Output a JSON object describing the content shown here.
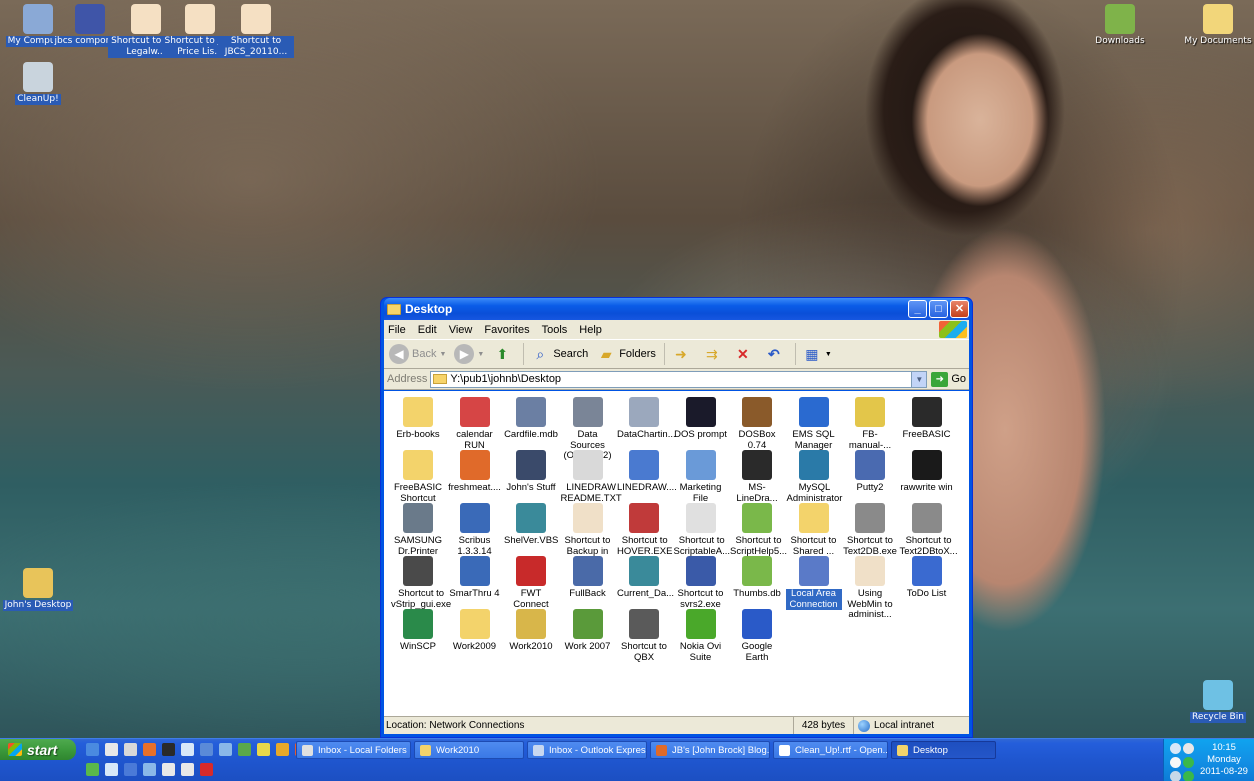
{
  "desktop": {
    "icons": [
      {
        "label": "My Computer",
        "icon": "computer-icon",
        "color": "#8aa9d6"
      },
      {
        "label": "jbcs compone...",
        "icon": "component-icon",
        "color": "#3f55a8"
      },
      {
        "label": "Shortcut to The Legalw...",
        "icon": "pdf-icon",
        "color": "#f5e0c3"
      },
      {
        "label": "Shortcut to jbcs Price Lis...",
        "icon": "pdf-icon",
        "color": "#f5e0c3"
      },
      {
        "label": "Shortcut to JBCS_20110...",
        "icon": "pdf-icon",
        "color": "#f5e0c3"
      },
      {
        "label": "CleanUp!",
        "icon": "cleanup-icon",
        "color": "#c9d4dd"
      },
      {
        "label": "John's Desktop",
        "icon": "network-folder-icon",
        "color": "#e8c45a"
      },
      {
        "label": "Downloads",
        "icon": "downloads-icon",
        "color": "#7fb34a"
      },
      {
        "label": "My Documents",
        "icon": "documents-icon",
        "color": "#f2d67a"
      },
      {
        "label": "Recycle Bin",
        "icon": "recycle-bin-icon",
        "color": "#6ec1e4"
      }
    ]
  },
  "window": {
    "title": "Desktop",
    "menu": [
      "File",
      "Edit",
      "View",
      "Favorites",
      "Tools",
      "Help"
    ],
    "toolbar": {
      "back": "Back",
      "search": "Search",
      "folders": "Folders"
    },
    "address": {
      "label": "Address",
      "value": "Y:\\pub1\\johnb\\Desktop",
      "go": "Go"
    },
    "files": [
      {
        "label": "Erb-books",
        "icon": "folder-icon",
        "color": "#f3d36b"
      },
      {
        "label": "calendar RUN",
        "icon": "document-icon",
        "color": "#d64545"
      },
      {
        "label": "Cardfile.mdb",
        "icon": "database-icon",
        "color": "#6b7fa3"
      },
      {
        "label": "Data Sources (ODBC) (2)",
        "icon": "odbc-icon",
        "color": "#7a8597"
      },
      {
        "label": "DataChartin...",
        "icon": "chart-icon",
        "color": "#9ba8bd"
      },
      {
        "label": "DOS prompt",
        "icon": "terminal-icon",
        "color": "#1a1a2a"
      },
      {
        "label": "DOSBox 0.74",
        "icon": "dosbox-icon",
        "color": "#8a5a2a"
      },
      {
        "label": "EMS SQL Manager 20...",
        "icon": "app-icon",
        "color": "#2a6ad0"
      },
      {
        "label": "FB-manual-...",
        "icon": "help-icon",
        "color": "#e3c64a"
      },
      {
        "label": "FreeBASIC",
        "icon": "horse-icon",
        "color": "#2a2a2a"
      },
      {
        "label": "FreeBASIC Shortcut",
        "icon": "folder-icon",
        "color": "#f3d36b"
      },
      {
        "label": "freshmeat....",
        "icon": "document-icon",
        "color": "#e06a2a"
      },
      {
        "label": "John's Stuff",
        "icon": "monitor-icon",
        "color": "#3a4a6a"
      },
      {
        "label": "LINEDRAW README.TXT",
        "icon": "text-icon",
        "color": "#d9d9d9"
      },
      {
        "label": "LINEDRAW....",
        "icon": "font-icon",
        "color": "#4a7ad0"
      },
      {
        "label": "Marketing File",
        "icon": "document-icon",
        "color": "#6a9ad8"
      },
      {
        "label": "MS-LineDra...",
        "icon": "window-icon",
        "color": "#2a2a2a"
      },
      {
        "label": "MySQL Administrator",
        "icon": "mysql-icon",
        "color": "#2a7aa8"
      },
      {
        "label": "Putty2",
        "icon": "putty-icon",
        "color": "#4a6ab0"
      },
      {
        "label": "rawwrite win",
        "icon": "penguin-icon",
        "color": "#1a1a1a"
      },
      {
        "label": "SAMSUNG Dr.Printer",
        "icon": "printer-icon",
        "color": "#6a7a8a"
      },
      {
        "label": "Scribus 1.3.3.14",
        "icon": "scribus-icon",
        "color": "#3a6ab8"
      },
      {
        "label": "ShelVer.VBS",
        "icon": "script-icon",
        "color": "#3a8a9a"
      },
      {
        "label": "Shortcut to Backup in t...",
        "icon": "pdf-icon",
        "color": "#f0e0c8"
      },
      {
        "label": "Shortcut to HOVER.EXE",
        "icon": "app-icon",
        "color": "#c03a3a"
      },
      {
        "label": "Shortcut to ScriptableA...",
        "icon": "flag-icon",
        "color": "#e0e0e0"
      },
      {
        "label": "Shortcut to ScriptHelp5...",
        "icon": "app-icon",
        "color": "#7ab84a"
      },
      {
        "label": "Shortcut to Shared ...",
        "icon": "folder-icon",
        "color": "#f3d36b"
      },
      {
        "label": "Shortcut to Text2DB.exe",
        "icon": "app-icon",
        "color": "#8a8a8a"
      },
      {
        "label": "Shortcut to Text2DBtoX...",
        "icon": "app-icon",
        "color": "#8a8a8a"
      },
      {
        "label": "Shortcut to vStrip_gui.exe",
        "icon": "app-icon",
        "color": "#4a4a4a"
      },
      {
        "label": "SmarThru 4",
        "icon": "app-icon",
        "color": "#3a6ab8"
      },
      {
        "label": "FWT Connect",
        "icon": "app-icon",
        "color": "#c82a2a"
      },
      {
        "label": "FullBack",
        "icon": "app-icon",
        "color": "#4a6aa8"
      },
      {
        "label": "Current_Da...",
        "icon": "script-icon",
        "color": "#3a8a9a"
      },
      {
        "label": "Shortcut to svrs2.exe",
        "icon": "app-icon",
        "color": "#3a5aa8"
      },
      {
        "label": "Thumbs.db",
        "icon": "image-icon",
        "color": "#7ab84a"
      },
      {
        "label": "Local Area Connection",
        "icon": "network-icon",
        "color": "#5a7ac8"
      },
      {
        "label": "Using WebMin to administ...",
        "icon": "pdf-icon",
        "color": "#f0e0c8"
      },
      {
        "label": "ToDo List",
        "icon": "app-icon",
        "color": "#3a6ad0"
      },
      {
        "label": "WinSCP",
        "icon": "winscp-icon",
        "color": "#2a8a4a"
      },
      {
        "label": "Work2009",
        "icon": "folder-icon",
        "color": "#f3d36b"
      },
      {
        "label": "Work2010",
        "icon": "folder-icon",
        "color": "#d8b64a"
      },
      {
        "label": "Work 2007",
        "icon": "app-icon",
        "color": "#5a9a3a"
      },
      {
        "label": "Shortcut to QBX",
        "icon": "app-icon",
        "color": "#5a5a5a"
      },
      {
        "label": "Nokia Ovi Suite",
        "icon": "ovi-icon",
        "color": "#4aa82a"
      },
      {
        "label": "Google Earth",
        "icon": "globe-icon",
        "color": "#2a5ac8"
      }
    ],
    "selected_file": "Local Area Connection",
    "status": {
      "location": "Location: Network Connections",
      "size": "428 bytes",
      "zone": "Local intranet"
    }
  },
  "taskbar": {
    "start": "start",
    "tasks": [
      {
        "label": "Inbox - Local Folders ...",
        "icon_color": "#e0e0e0"
      },
      {
        "label": "Work2010",
        "icon_color": "#f3d36b"
      },
      {
        "label": "Inbox - Outlook Express",
        "icon_color": "#c8d8f0"
      },
      {
        "label": "JB's [John Brock] Blog...",
        "icon_color": "#e06a2a"
      },
      {
        "label": "Clean_Up!.rtf - Open...",
        "icon_color": "#ffffff"
      },
      {
        "label": "Desktop",
        "icon_color": "#f3d36b"
      }
    ],
    "clock": {
      "time": "10:15",
      "day": "Monday",
      "date": "2011-08-29"
    }
  }
}
